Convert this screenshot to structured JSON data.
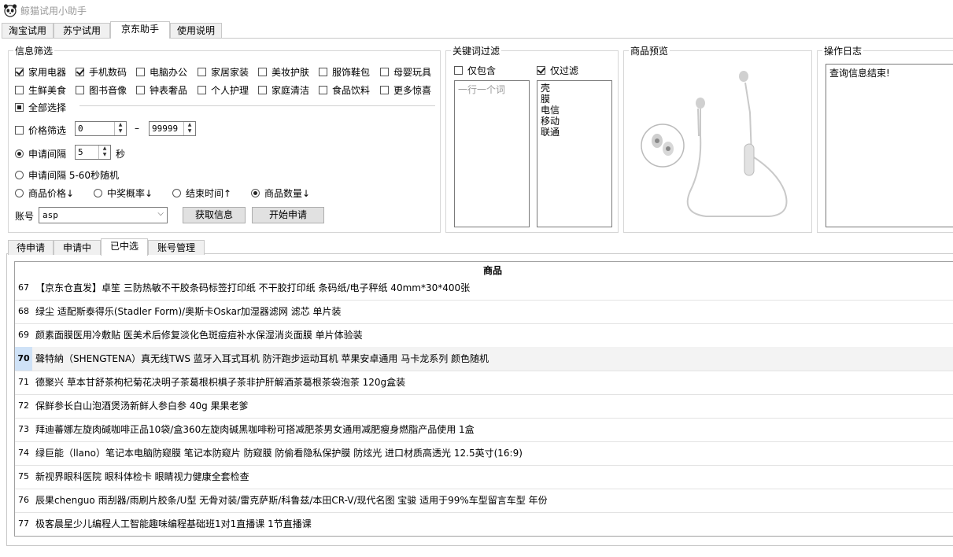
{
  "app": {
    "title": "鲸猫试用小助手"
  },
  "top_tabs": [
    {
      "label": "淘宝试用"
    },
    {
      "label": "苏宁试用"
    },
    {
      "label": "京东助手"
    },
    {
      "label": "使用说明"
    }
  ],
  "filter": {
    "title": "信息筛选",
    "categories": [
      {
        "label": "家用电器",
        "checked": true
      },
      {
        "label": "手机数码",
        "checked": true
      },
      {
        "label": "电脑办公",
        "checked": false
      },
      {
        "label": "家居家装",
        "checked": false
      },
      {
        "label": "美妆护肤",
        "checked": false
      },
      {
        "label": "服饰鞋包",
        "checked": false
      },
      {
        "label": "母婴玩具",
        "checked": false
      },
      {
        "label": "生鲜美食",
        "checked": false
      },
      {
        "label": "图书音像",
        "checked": false
      },
      {
        "label": "钟表奢品",
        "checked": false
      },
      {
        "label": "个人护理",
        "checked": false
      },
      {
        "label": "家庭清洁",
        "checked": false
      },
      {
        "label": "食品饮料",
        "checked": false
      },
      {
        "label": "更多惊喜",
        "checked": false
      }
    ],
    "select_all": "全部选择",
    "price_filter": {
      "label": "价格筛选",
      "min": "0",
      "dash": "–",
      "max": "99999"
    },
    "interval": {
      "label": "申请间隔",
      "value": "5",
      "unit": "秒"
    },
    "random_interval": {
      "label": "申请间隔 5-60秒随机"
    },
    "sort_options": [
      {
        "label": "商品价格↓",
        "checked": false
      },
      {
        "label": "中奖概率↓",
        "checked": false
      },
      {
        "label": "结束时间↑",
        "checked": false
      },
      {
        "label": "商品数量↓",
        "checked": true
      }
    ],
    "account": {
      "label": "账号",
      "value": "asp"
    },
    "fetch_button": "获取信息",
    "start_button": "开始申请"
  },
  "keyword_filter": {
    "title": "关键词过滤",
    "include_only": {
      "label": "仅包含",
      "checked": false
    },
    "filter_only": {
      "label": "仅过滤",
      "checked": true
    },
    "include_placeholder": "一行一个词",
    "filter_words": [
      "壳",
      "膜",
      "电信",
      "移动",
      "联通"
    ]
  },
  "preview": {
    "title": "商品预览"
  },
  "log": {
    "title": "操作日志",
    "text": "查询信息结束!"
  },
  "bottom_tabs": [
    {
      "label": "待申请"
    },
    {
      "label": "申请中"
    },
    {
      "label": "已中选"
    },
    {
      "label": "账号管理"
    }
  ],
  "table": {
    "header": "商品",
    "rows": [
      {
        "num": "67",
        "text": "【京东仓直发】卓笙 三防热敏不干胶条码标签打印纸 不干胶打印纸 条码纸/电子秤纸 40mm*30*400张"
      },
      {
        "num": "68",
        "text": "绿尘 适配斯泰得乐(Stadler Form)/奥斯卡Oskar加湿器滤网 滤芯 单片装"
      },
      {
        "num": "69",
        "text": "颜素面膜医用冷敷贴 医美术后修复淡化色斑痘痘补水保湿消炎面膜 单片体验装"
      },
      {
        "num": "70",
        "text": "聲特納（SHENGTENA）真无线TWS 蓝牙入耳式耳机 防汗跑步运动耳机 苹果安卓通用 马卡龙系列 颜色随机",
        "selected": true
      },
      {
        "num": "71",
        "text": "德聚兴 草本甘舒茶枸杞菊花决明子茶葛根枳椇子茶非护肝解酒茶葛根茶袋泡茶 120g盒装"
      },
      {
        "num": "72",
        "text": "保鲜参长白山泡酒煲汤新鲜人参白参  40g 果果老爹"
      },
      {
        "num": "73",
        "text": "拜迪蕃娜左旋肉碱咖啡正品10袋/盒360左旋肉碱黑咖啡粉可搭减肥茶男女通用减肥瘦身燃脂产品使用 1盒"
      },
      {
        "num": "74",
        "text": "绿巨能（llano）笔记本电脑防窥膜 笔记本防窥片 防窥膜 防偷看隐私保护膜 防炫光 进口材质高透光 12.5英寸(16:9)"
      },
      {
        "num": "75",
        "text": "新视界眼科医院 眼科体检卡 眼睛视力健康全套检查"
      },
      {
        "num": "76",
        "text": "辰果chenguo 雨刮器/雨刷片胶条/U型 无骨对装/雷克萨斯/科鲁兹/本田CR-V/现代名图 宝骏 适用于99%车型留言车型 年份"
      },
      {
        "num": "77",
        "text": "极客晨星少儿编程人工智能趣味编程基础班1对1直播课 1节直播课"
      }
    ]
  }
}
